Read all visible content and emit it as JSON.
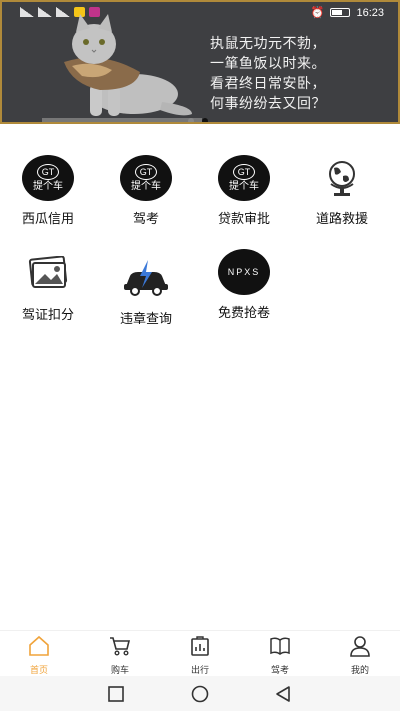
{
  "status_bar": {
    "time": "16:23"
  },
  "banner": {
    "poem_lines": [
      "执鼠无功元不勃，",
      "一箪鱼饭以时来。",
      "看君终日常安卧，",
      "何事纷纷去又回？"
    ]
  },
  "services": [
    {
      "label": "西瓜信用",
      "icon": "tigechei-logo",
      "logo_text": "提个车"
    },
    {
      "label": "驾考",
      "icon": "tigechei-logo",
      "logo_text": "提个车"
    },
    {
      "label": "贷款审批",
      "icon": "tigechei-logo",
      "logo_text": "提个车"
    },
    {
      "label": "道路救援",
      "icon": "globe-icon"
    },
    {
      "label": "驾证扣分",
      "icon": "photo-icon"
    },
    {
      "label": "违章查询",
      "icon": "car-bolt-icon"
    },
    {
      "label": "免费抢卷",
      "icon": "npxs-logo",
      "logo_text": "NPXS"
    }
  ],
  "tabs": [
    {
      "label": "首页",
      "icon": "home-icon",
      "active": true
    },
    {
      "label": "购车",
      "icon": "cart-icon"
    },
    {
      "label": "出行",
      "icon": "chart-bag-icon"
    },
    {
      "label": "驾考",
      "icon": "book-icon"
    },
    {
      "label": "我的",
      "icon": "user-icon"
    }
  ],
  "colors": {
    "accent": "#f0a33a",
    "banner_bg": "#3e3f42",
    "banner_border": "#b08a3a"
  }
}
